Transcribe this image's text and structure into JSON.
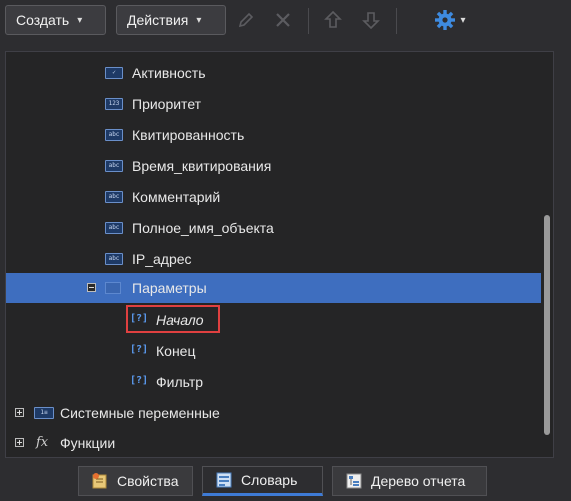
{
  "toolbar": {
    "create_label": "Создать",
    "actions_label": "Действия"
  },
  "tree": {
    "fields": [
      {
        "label": "Активность",
        "icon": "checkbox-field-icon"
      },
      {
        "label": "Приоритет",
        "icon": "number-field-icon"
      },
      {
        "label": "Квитированность",
        "icon": "string-field-icon"
      },
      {
        "label": "Время_квитирования",
        "icon": "string-field-icon"
      },
      {
        "label": "Комментарий",
        "icon": "string-field-icon"
      },
      {
        "label": "Полное_имя_объекта",
        "icon": "string-field-icon"
      },
      {
        "label": "IP_адрес",
        "icon": "string-field-icon"
      }
    ],
    "parameters_label": "Параметры",
    "parameters": [
      {
        "label": "Начало"
      },
      {
        "label": "Конец"
      },
      {
        "label": "Фильтр"
      }
    ],
    "system_variables_label": "Системные переменные",
    "functions_label": "Функции",
    "functions_icon_text": "fx"
  },
  "tabs": [
    {
      "label": "Свойства",
      "active": false
    },
    {
      "label": "Словарь",
      "active": true
    },
    {
      "label": "Дерево отчета",
      "active": false
    }
  ],
  "colors": {
    "selection": "#3e6ebf",
    "highlight": "#e04040",
    "gear": "#3e8be0"
  }
}
